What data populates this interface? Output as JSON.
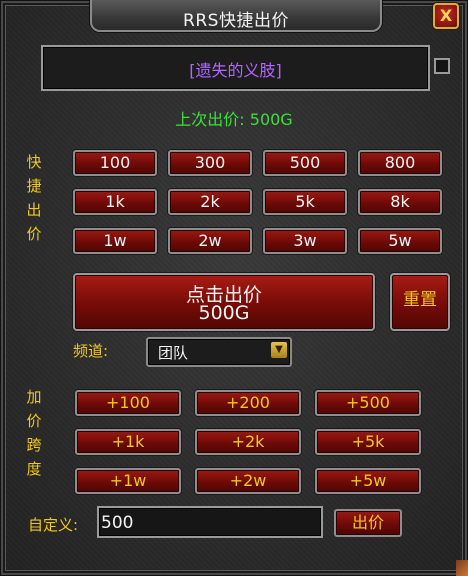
{
  "window": {
    "title": "RRS快捷出价",
    "close_label": "X"
  },
  "item": {
    "name": "[遗失的义肢]"
  },
  "last_bid": "上次出价: 500G",
  "quick_bid": {
    "label": [
      "快",
      "捷",
      "出",
      "价"
    ],
    "buttons": [
      "100",
      "300",
      "500",
      "800",
      "1k",
      "2k",
      "5k",
      "8k",
      "1w",
      "2w",
      "3w",
      "5w"
    ]
  },
  "bid_button": {
    "line1": "点击出价",
    "line2": "500G"
  },
  "reset_label": "重置",
  "channel": {
    "label": "频道:",
    "value": "团队"
  },
  "increment": {
    "label": [
      "加",
      "价",
      "跨",
      "度"
    ],
    "buttons": [
      "+100",
      "+200",
      "+500",
      "+1k",
      "+2k",
      "+5k",
      "+1w",
      "+2w",
      "+5w"
    ]
  },
  "custom": {
    "label": "自定义:",
    "value": "500",
    "submit_label": "出价"
  },
  "colors": {
    "accent_gold": "#f0c81e",
    "bid_green": "#3be03b",
    "item_purple": "#b464ff",
    "button_red": "#7a0c08"
  }
}
